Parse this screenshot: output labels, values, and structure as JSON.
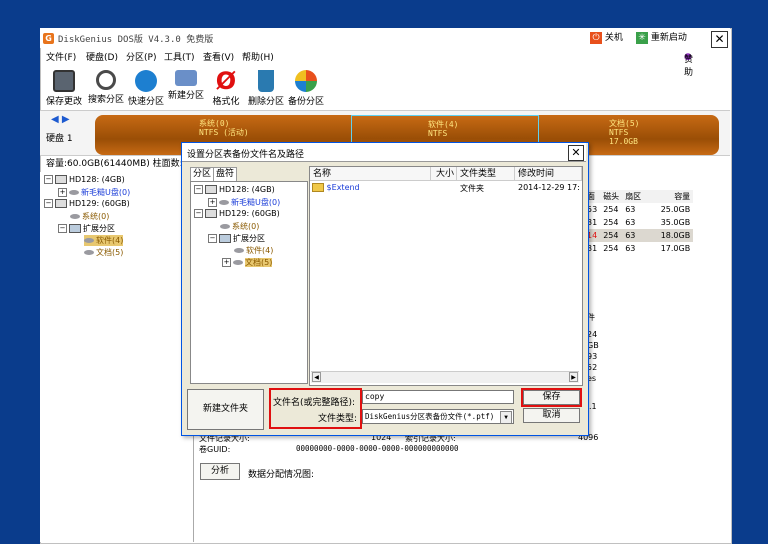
{
  "app": {
    "title": "DiskGenius DOS版 V4.3.0 免费版",
    "logo_letter": "G",
    "shutdown": "关机",
    "restart": "重新启动",
    "donate": "赞助"
  },
  "menu": [
    "文件(F)",
    "硬盘(D)",
    "分区(P)",
    "工具(T)",
    "查看(V)",
    "帮助(H)"
  ],
  "toolbar": [
    "保存更改",
    "搜索分区",
    "快速分区",
    "新建分区",
    "格式化",
    "删除分区",
    "备份分区"
  ],
  "disk": {
    "label": "硬盘 1",
    "segments": [
      {
        "name": "系统(0)",
        "fs": "NTFS (活动)"
      },
      {
        "name": "软件(4)",
        "fs": "NTFS",
        "size": "18.0GB"
      },
      {
        "name": "文档(5)",
        "fs": "NTFS",
        "size": "17.0GB"
      }
    ],
    "info": "容量:60.0GB(61440MB)   柱面数:7"
  },
  "tree": [
    {
      "label": "HD128: (4GB)",
      "type": "disk"
    },
    {
      "label": "新毛糙U盘(0)",
      "type": "part"
    },
    {
      "label": "HD129: (60GB)",
      "type": "disk"
    },
    {
      "label": "系统(0)",
      "type": "part"
    },
    {
      "label": "扩展分区",
      "type": "ext"
    },
    {
      "label": "软件(4)",
      "type": "part"
    },
    {
      "label": "文档(5)",
      "type": "part"
    }
  ],
  "partition_table": {
    "headers": [
      "面",
      "磁头",
      "扇区",
      "容量"
    ],
    "rows": [
      [
        "53",
        "254",
        "63",
        "25.0GB"
      ],
      [
        "31",
        "254",
        "63",
        "35.0GB"
      ],
      [
        "14",
        "254",
        "63",
        "18.0GB"
      ],
      [
        "31",
        "254",
        "63",
        "17.0GB"
      ]
    ]
  },
  "right_fragments": [
    "件",
    "24",
    "GB",
    "93",
    "52",
    "es",
    ".1",
    "096"
  ],
  "details": {
    "file_record_label": "文件记录大小:",
    "file_record_value": "1024",
    "index_record_label": "索引记录大小:",
    "index_record_value": "4096",
    "guid_label": "卷GUID:",
    "guid_value": "00000000-0000-0000-0000-000000000000",
    "analyze_button": "分析",
    "alloc_label": "数据分配情况图:"
  },
  "dialog": {
    "title": "设置分区表备份文件名及路径",
    "tabs": [
      "分区",
      "盘符"
    ],
    "tree": [
      {
        "label": "HD128: (4GB)",
        "type": "disk"
      },
      {
        "label": "新毛糙U盘(0)",
        "type": "part"
      },
      {
        "label": "HD129: (60GB)",
        "type": "disk"
      },
      {
        "label": "系统(0)",
        "type": "part"
      },
      {
        "label": "扩展分区",
        "type": "ext"
      },
      {
        "label": "软件(4)",
        "type": "part"
      },
      {
        "label": "文档(5)",
        "type": "part"
      }
    ],
    "columns": [
      "名称",
      "大小",
      "文件类型",
      "修改时间"
    ],
    "files": [
      {
        "name": "$Extend",
        "size": "",
        "type": "文件夹",
        "modified": "2014-12-29 17:"
      }
    ],
    "new_folder": "新建文件夹",
    "filename_label": "文件名(或完整路径):",
    "filename_value": "copy",
    "filetype_label": "文件类型:",
    "filetype_value": "DiskGenius分区表备份文件(*.ptf)",
    "save": "保存",
    "cancel": "取消"
  },
  "colors": {
    "desktop": "#0a3c8c",
    "disk_segment": "#c76a14",
    "highlight": "#e01010",
    "link": "#1a3cd8"
  }
}
